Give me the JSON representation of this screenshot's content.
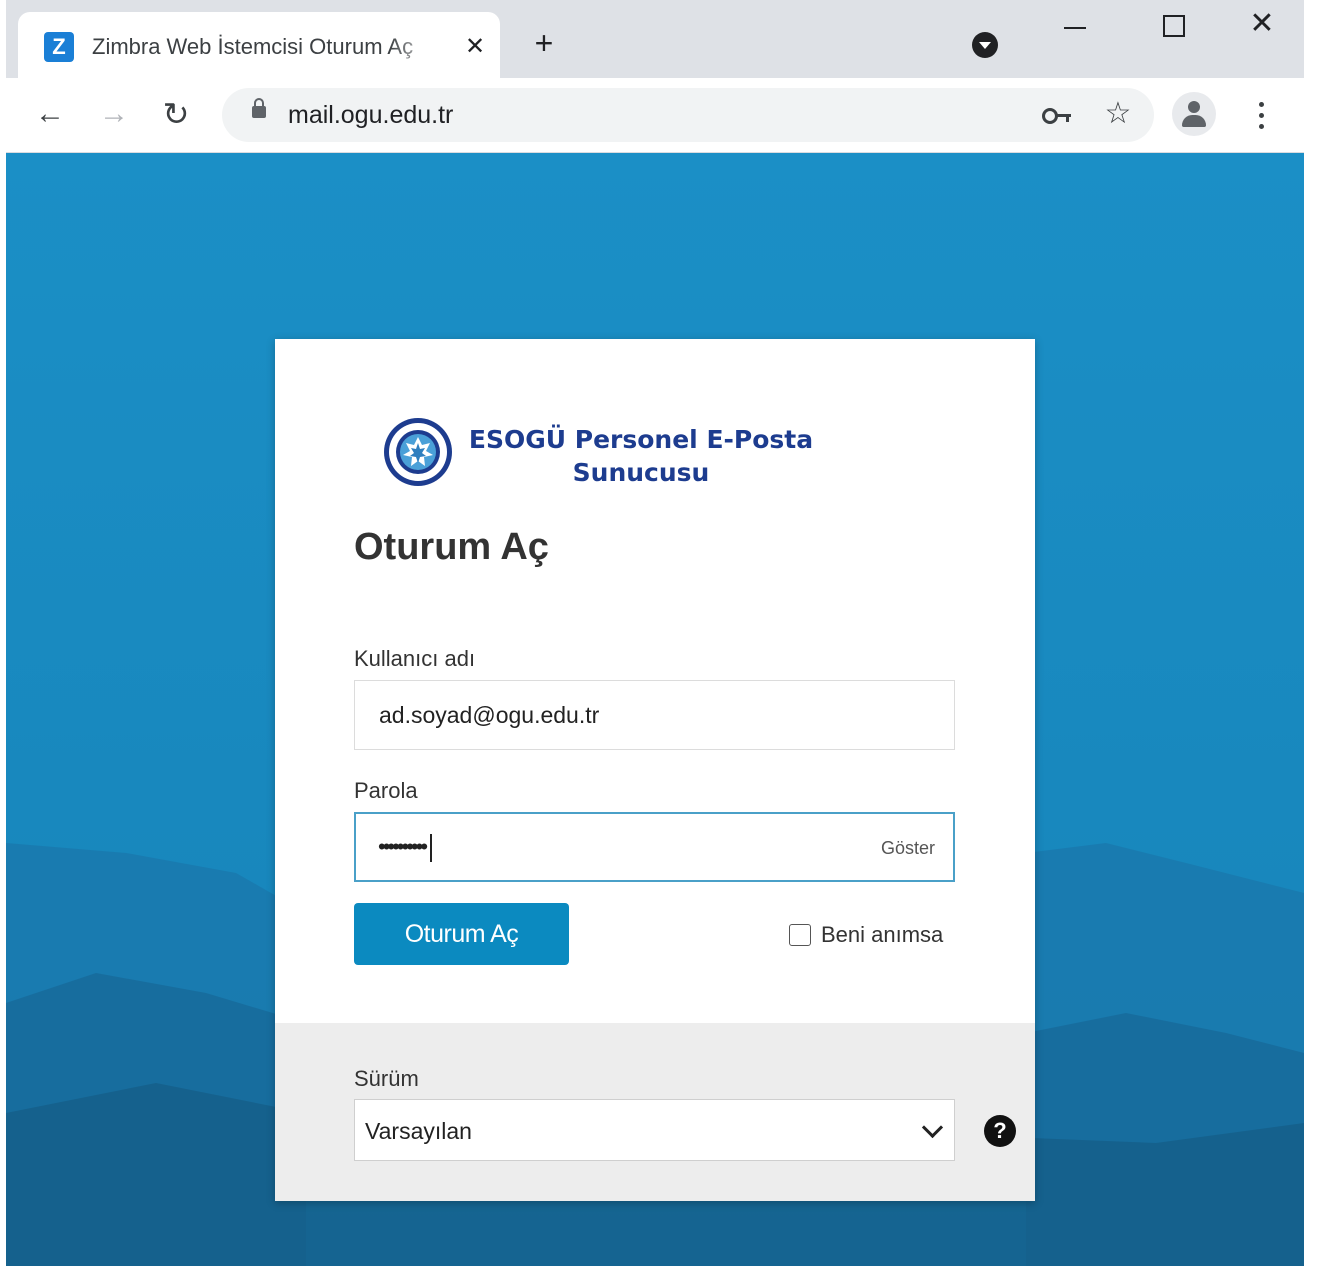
{
  "browser": {
    "tab": {
      "favicon_letter": "Z",
      "title": "Zimbra Web İstemcisi Oturum Aç",
      "close_glyph": "✕"
    },
    "new_tab_glyph": "+",
    "window_close_glyph": "✕",
    "toolbar": {
      "back_glyph": "←",
      "forward_glyph": "→",
      "reload_glyph": "↻",
      "url": "mail.ogu.edu.tr",
      "star_glyph": "☆"
    },
    "icons": [
      "tab-search-icon",
      "minimize-icon",
      "maximize-icon",
      "close-icon",
      "back-arrow-icon",
      "forward-arrow-icon",
      "reload-icon",
      "lock-icon",
      "key-icon",
      "star-icon",
      "profile-icon",
      "kebab-menu-icon"
    ]
  },
  "login": {
    "brand_line1": "ESOGÜ Personel E-Posta",
    "brand_line2": "Sunucusu",
    "heading": "Oturum Aç",
    "username_label": "Kullanıcı adı",
    "username_value": "ad.soyad@ogu.edu.tr",
    "password_label": "Parola",
    "password_mask": "••••••••••",
    "show_label": "Göster",
    "submit_label": "Oturum Aç",
    "remember_label": "Beni anımsa",
    "remember_checked": false,
    "version_label": "Sürüm",
    "version_value": "Varsayılan",
    "help_glyph": "?"
  },
  "colors": {
    "page_background": "#1a8bc3",
    "primary_button": "#0b8ac0",
    "brand_text": "#1d3c8f",
    "focus_border": "#4aa0c8",
    "footer_background": "#ededed"
  }
}
